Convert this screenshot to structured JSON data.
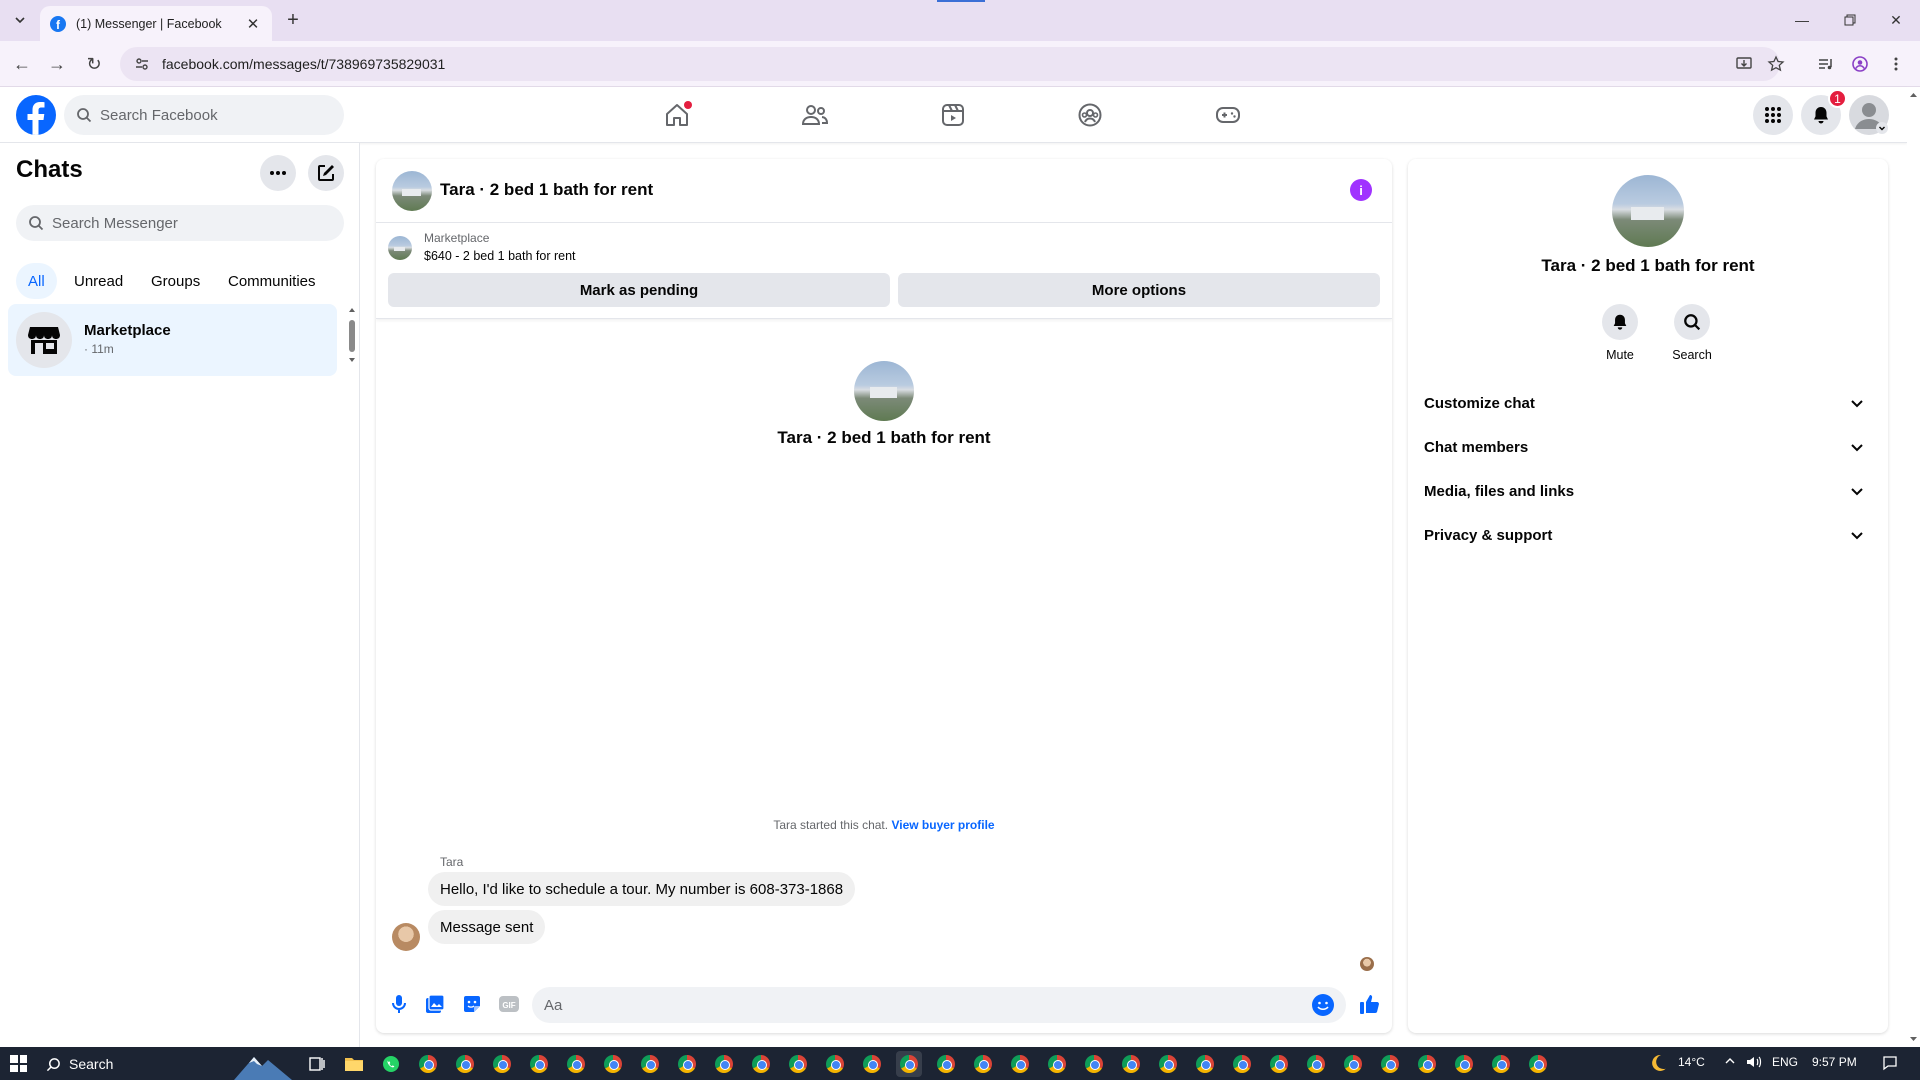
{
  "browser": {
    "tab_title": "(1) Messenger | Facebook",
    "url": "facebook.com/messages/t/738969735829031"
  },
  "fb": {
    "search_placeholder": "Search Facebook",
    "notification_count": "1"
  },
  "chats": {
    "title": "Chats",
    "search_placeholder": "Search Messenger",
    "filters": [
      "All",
      "Unread",
      "Groups",
      "Communities"
    ],
    "active_filter": "All",
    "items": [
      {
        "name": "Marketplace",
        "time": "· 11m"
      }
    ]
  },
  "conversation": {
    "name": "Tara · 2 bed 1 bath for rent",
    "marketplace_label": "Marketplace",
    "listing": "$640 - 2 bed 1 bath for rent",
    "mark_pending_label": "Mark as pending",
    "more_options_label": "More options",
    "started_text": "Tara started this chat.",
    "view_buyer_profile": "View buyer profile",
    "sender": "Tara",
    "messages": [
      "Hello, I'd like to schedule a tour. My number is 608-373-1868",
      "Message sent"
    ],
    "composer_placeholder": "Aa"
  },
  "info_panel": {
    "name": "Tara · 2 bed 1 bath for rent",
    "mute_label": "Mute",
    "search_label": "Search",
    "sections": [
      "Customize chat",
      "Chat members",
      "Media, files and links",
      "Privacy & support"
    ]
  },
  "taskbar": {
    "search_label": "Search",
    "temperature": "14°C",
    "language": "ENG",
    "time": "9:57 PM"
  },
  "colors": {
    "accent": "#0866ff",
    "active_filter_bg": "#ebf5ff",
    "info_icon": "#a033ff",
    "badge": "#e41e3f"
  }
}
